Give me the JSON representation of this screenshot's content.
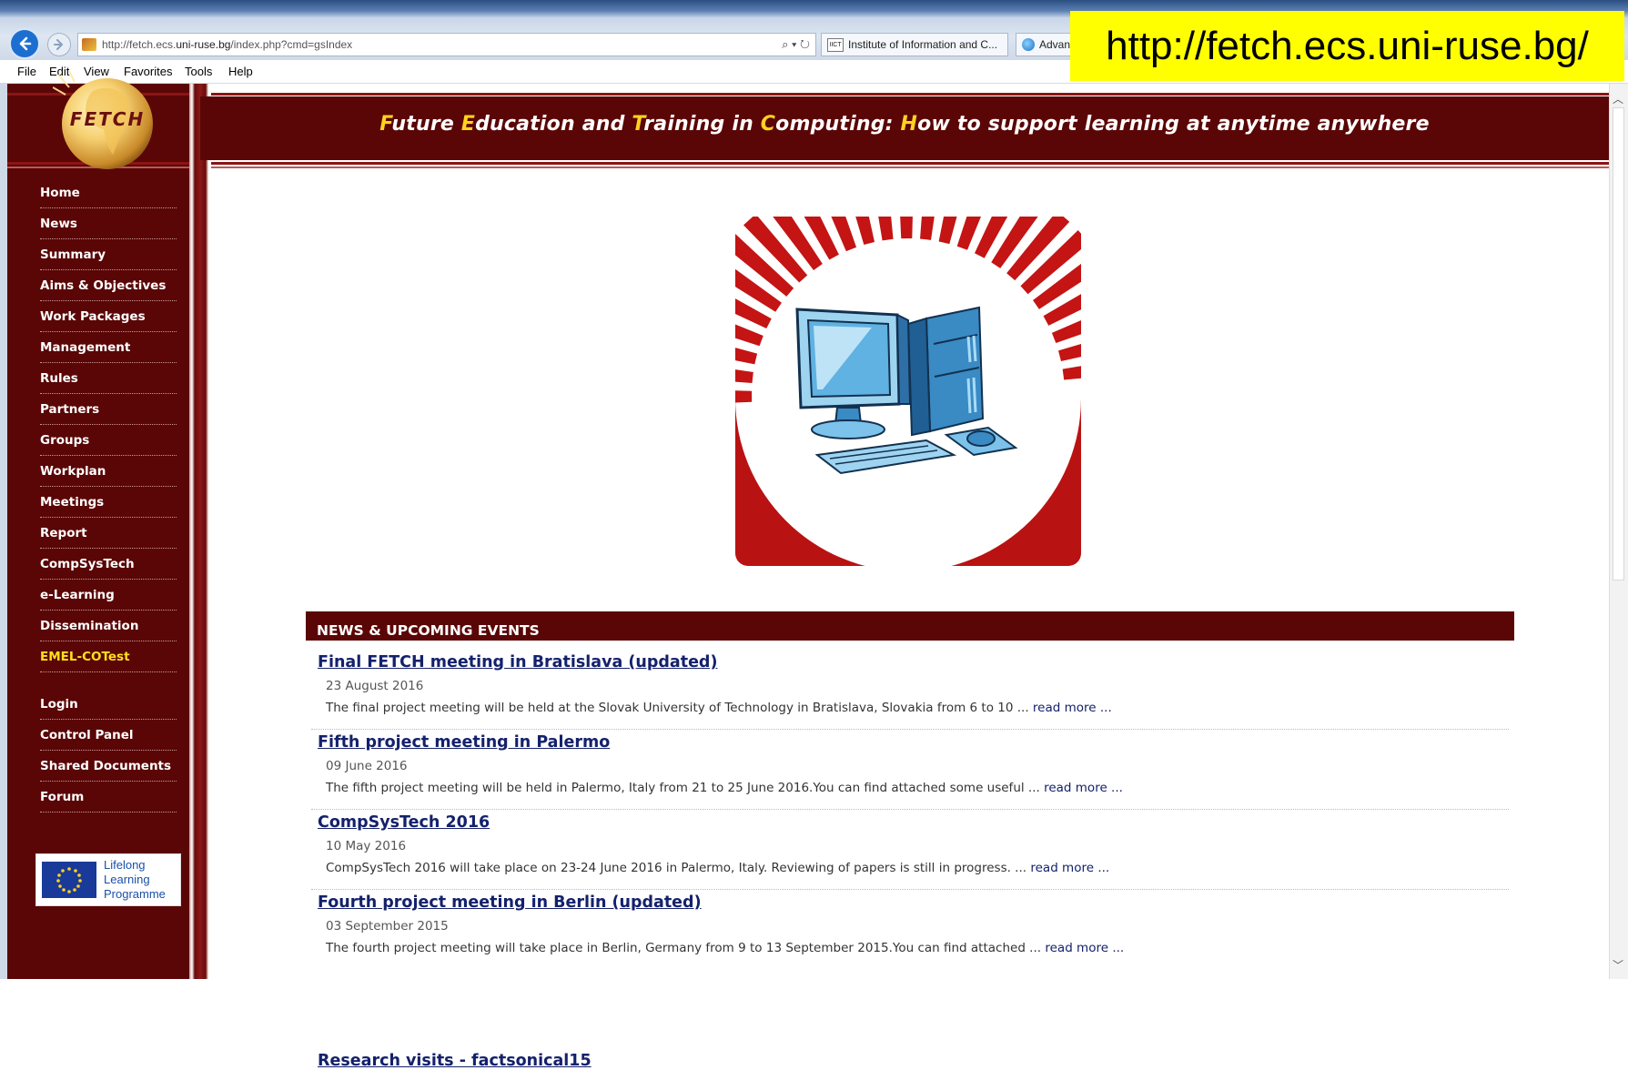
{
  "browser": {
    "address_prefix": "http://fetch.ecs.",
    "address_host": "uni-ruse.bg",
    "address_path": "/index.php?cmd=gsIndex",
    "search_glyph": "⌕ ▾ ↻",
    "tabs": [
      {
        "icon": "IICT",
        "label": "Institute of Information and C..."
      },
      {
        "label": "Advan"
      }
    ],
    "menu": [
      "File",
      "Edit",
      "View",
      "Favorites",
      "Tools",
      "Help"
    ]
  },
  "banner": {
    "url": "http://fetch.ecs.uni-ruse.bg/"
  },
  "header": {
    "logo_text": "FETCH",
    "tagline_parts": [
      {
        "hl": "F",
        "rest": "uture "
      },
      {
        "hl": "E",
        "rest": "ducation and "
      },
      {
        "hl": "T",
        "rest": "raining in "
      },
      {
        "hl": "C",
        "rest": "omputing: "
      },
      {
        "hl": "H",
        "rest": "ow to support learning at anytime anywhere"
      }
    ]
  },
  "sidebar": {
    "menu": [
      "Home",
      "News",
      "Summary",
      "Aims & Objectives",
      "Work Packages",
      "Management",
      "Rules",
      "Partners",
      "Groups",
      "Workplan",
      "Meetings",
      "Report",
      "CompSysTech",
      "e-Learning",
      "Dissemination",
      "EMEL-COTest"
    ],
    "active": "EMEL-COTest",
    "user_menu": [
      "Login",
      "Control Panel",
      "Shared Documents",
      "Forum"
    ],
    "llp": {
      "line1": "Lifelong",
      "line2": "Learning",
      "line3": "Programme"
    }
  },
  "news": {
    "header": "NEWS & UPCOMING EVENTS",
    "items": [
      {
        "title": "Final FETCH meeting in Bratislava (updated)",
        "date": "23 August 2016",
        "summary": "The final project meeting will be held at the Slovak University of Technology in Bratislava, Slovakia from 6 to 10 ...",
        "more": "read more ..."
      },
      {
        "title": "Fifth project meeting in Palermo",
        "date": "09 June 2016",
        "summary": "The fifth project meeting will be held in Palermo, Italy from 21 to 25 June 2016.You can find attached some useful ...",
        "more": "read more ..."
      },
      {
        "title": "CompSysTech 2016",
        "date": "10 May 2016",
        "summary": "CompSysTech 2016 will take place on 23-24 June 2016 in Palermo, Italy. Reviewing of papers is still in progress. ...",
        "more": "read more ..."
      },
      {
        "title": "Fourth project meeting in Berlin (updated)",
        "date": "03 September 2015",
        "summary": "The fourth project meeting will take place in Berlin, Germany from 9 to 13 September 2015.You can find attached ...",
        "more": "read more ..."
      }
    ],
    "cut_off_title": "Research visits - factsonical15"
  },
  "colors": {
    "maroon": "#5a0606",
    "highlight_yellow": "#ffd21f",
    "banner_yellow": "#ffff00",
    "link_navy": "#14216b",
    "hero_red": "#c41414"
  }
}
